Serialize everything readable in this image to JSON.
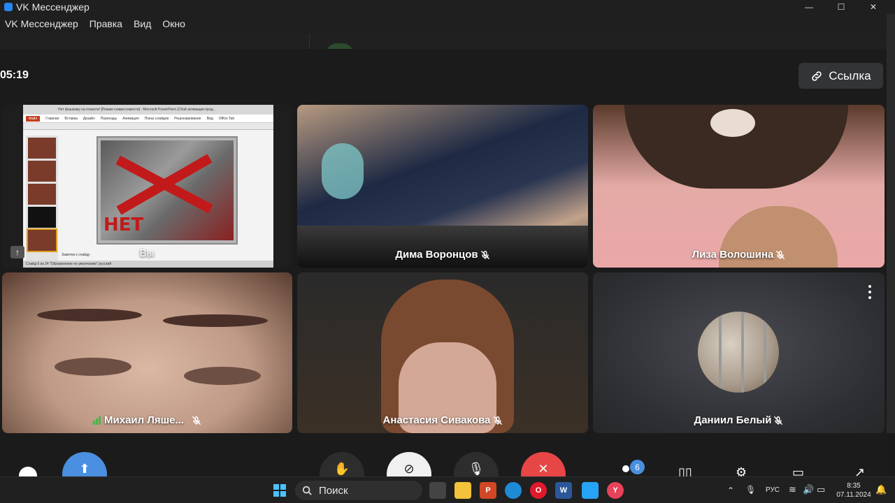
{
  "window": {
    "title": "VK Мессенджер",
    "controls": {
      "minimize": "—",
      "maximize": "☐",
      "close": "✕"
    }
  },
  "menu": [
    {
      "label": "VK Мессенджер"
    },
    {
      "label": "Правка"
    },
    {
      "label": "Вид"
    },
    {
      "label": "Окно"
    }
  ],
  "call": {
    "timer": "05:19",
    "link_button": {
      "label": "Ссылка",
      "icon": "link-icon"
    },
    "participants": [
      {
        "name": "Вы",
        "content": "screen-share",
        "muted": false
      },
      {
        "name": "Дима Воронцов",
        "muted": true
      },
      {
        "name": "Лиза Волошина",
        "muted": true
      },
      {
        "name": "Михаил Ляше...",
        "muted": true,
        "speaking_signal": true
      },
      {
        "name": "Анастасия Сивакова",
        "muted": true
      },
      {
        "name": "Даниил Белый",
        "muted": true,
        "camera": "off-avatar"
      }
    ],
    "screen_share": {
      "window_title": "Нет фашизму на планете! [Режим совместимости] - Microsoft PowerPoint (Сбой активации прод...",
      "file_tab": "Файл",
      "ribbon_tabs": [
        "Главная",
        "Вставка",
        "Дизайн",
        "Переходы",
        "Анимация",
        "Показ слайдов",
        "Рецензирование",
        "Вид",
        "Office Tab"
      ],
      "slide_text": "НЕТ",
      "notes": "Заметки к слайду",
      "status": "Слайд 6 из 24   \"Оформление по умолчанию\"   русский"
    },
    "participant_count": "6"
  },
  "taskbar": {
    "search_label": "Поиск",
    "language": "РУС",
    "time": "8:35",
    "date": "07.11.2024"
  },
  "colors": {
    "accent": "#4a8fe0",
    "hangup": "#e64646",
    "speaking": "#4bb34b"
  }
}
